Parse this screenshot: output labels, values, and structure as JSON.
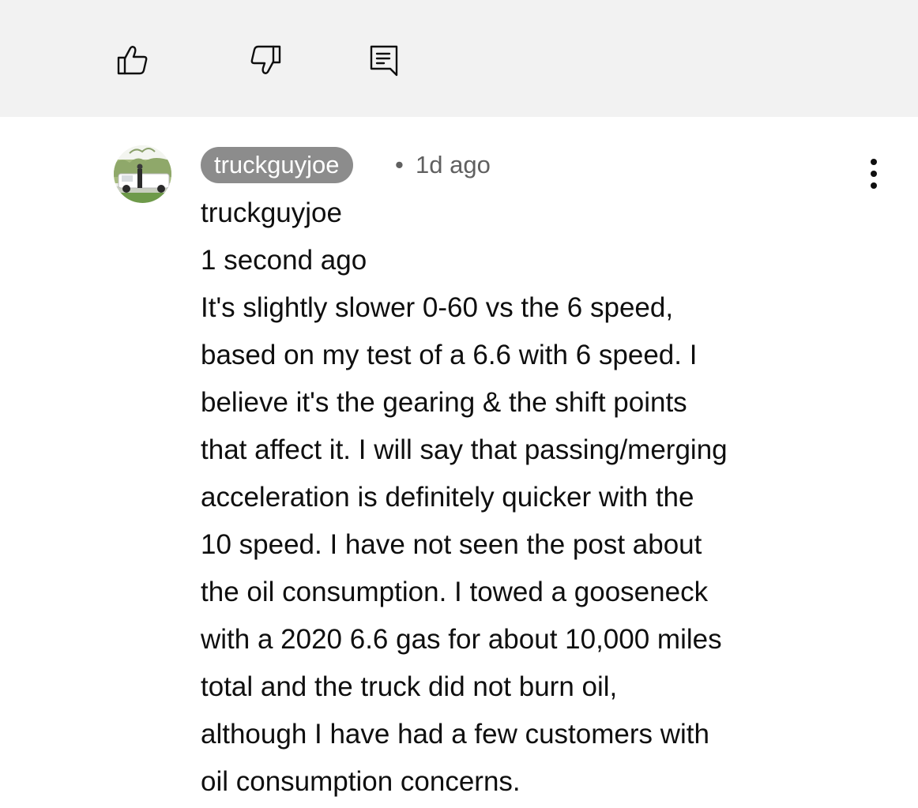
{
  "actions": {
    "like_icon": "thumb-up-icon",
    "dislike_icon": "thumb-down-icon",
    "reply_icon": "comment-icon"
  },
  "comment": {
    "author_handle": "truckguyjoe",
    "separator": "•",
    "timestamp": "1d ago",
    "more_icon": "more-vertical-icon",
    "body_lines": [
      "truckguyjoe",
      "1 second ago",
      "It's slightly slower 0-60 vs the 6 speed,",
      "based on my test of a 6.6 with 6 speed. I",
      "believe it's the gearing & the shift points",
      "that affect it. I will say that passing/merging",
      "acceleration is definitely quicker with the",
      "10 speed. I have not seen the post about",
      "the oil consumption. I towed a gooseneck",
      "with a 2020 6.6 gas for about 10,000 miles",
      "total and the truck did not burn oil,",
      "although I have had a few customers with",
      "oil consumption concerns."
    ]
  },
  "colors": {
    "action_bar_bg": "#f2f2f2",
    "author_chip_bg": "#8c8c8c",
    "secondary_text": "#606060",
    "primary_text": "#0f0f0f"
  }
}
